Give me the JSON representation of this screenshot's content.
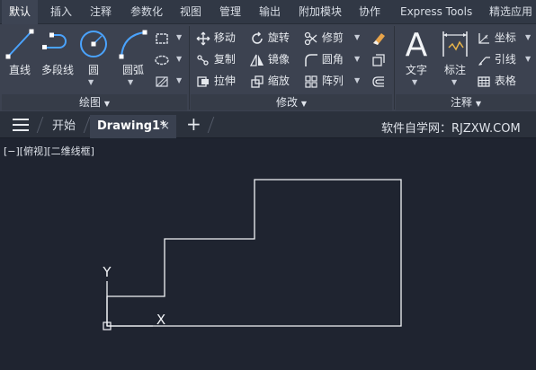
{
  "tabs": [
    "默认",
    "插入",
    "注释",
    "参数化",
    "视图",
    "管理",
    "输出",
    "附加模块",
    "协作",
    "Express Tools",
    "精选应用"
  ],
  "draw_panel": {
    "line": "直线",
    "polyline": "多段线",
    "circle": "圆",
    "arc": "圆弧",
    "title": "绘图"
  },
  "modify_panel": {
    "move": "移动",
    "rotate": "旋转",
    "trim": "修剪",
    "copy": "复制",
    "mirror": "镜像",
    "fillet": "圆角",
    "stretch": "拉伸",
    "scale": "缩放",
    "array": "阵列",
    "title": "修改"
  },
  "annotation_panel": {
    "text": "文字",
    "dimension": "标注",
    "coordinate": "坐标",
    "leader": "引线",
    "table": "表格",
    "title": "注释"
  },
  "doc_tabs": {
    "start": "开始",
    "drawing": "Drawing1*",
    "close": "×",
    "add": "+"
  },
  "watermark": "软件自学网：RJZXW.COM",
  "viewport": {
    "label": "[−][俯视][二维线框]",
    "axis_y": "Y",
    "axis_x": "X"
  },
  "colors": {
    "accent": "#4aa3ff",
    "ribbon_bg": "#3c4250",
    "canvas_bg": "#1f2430"
  }
}
